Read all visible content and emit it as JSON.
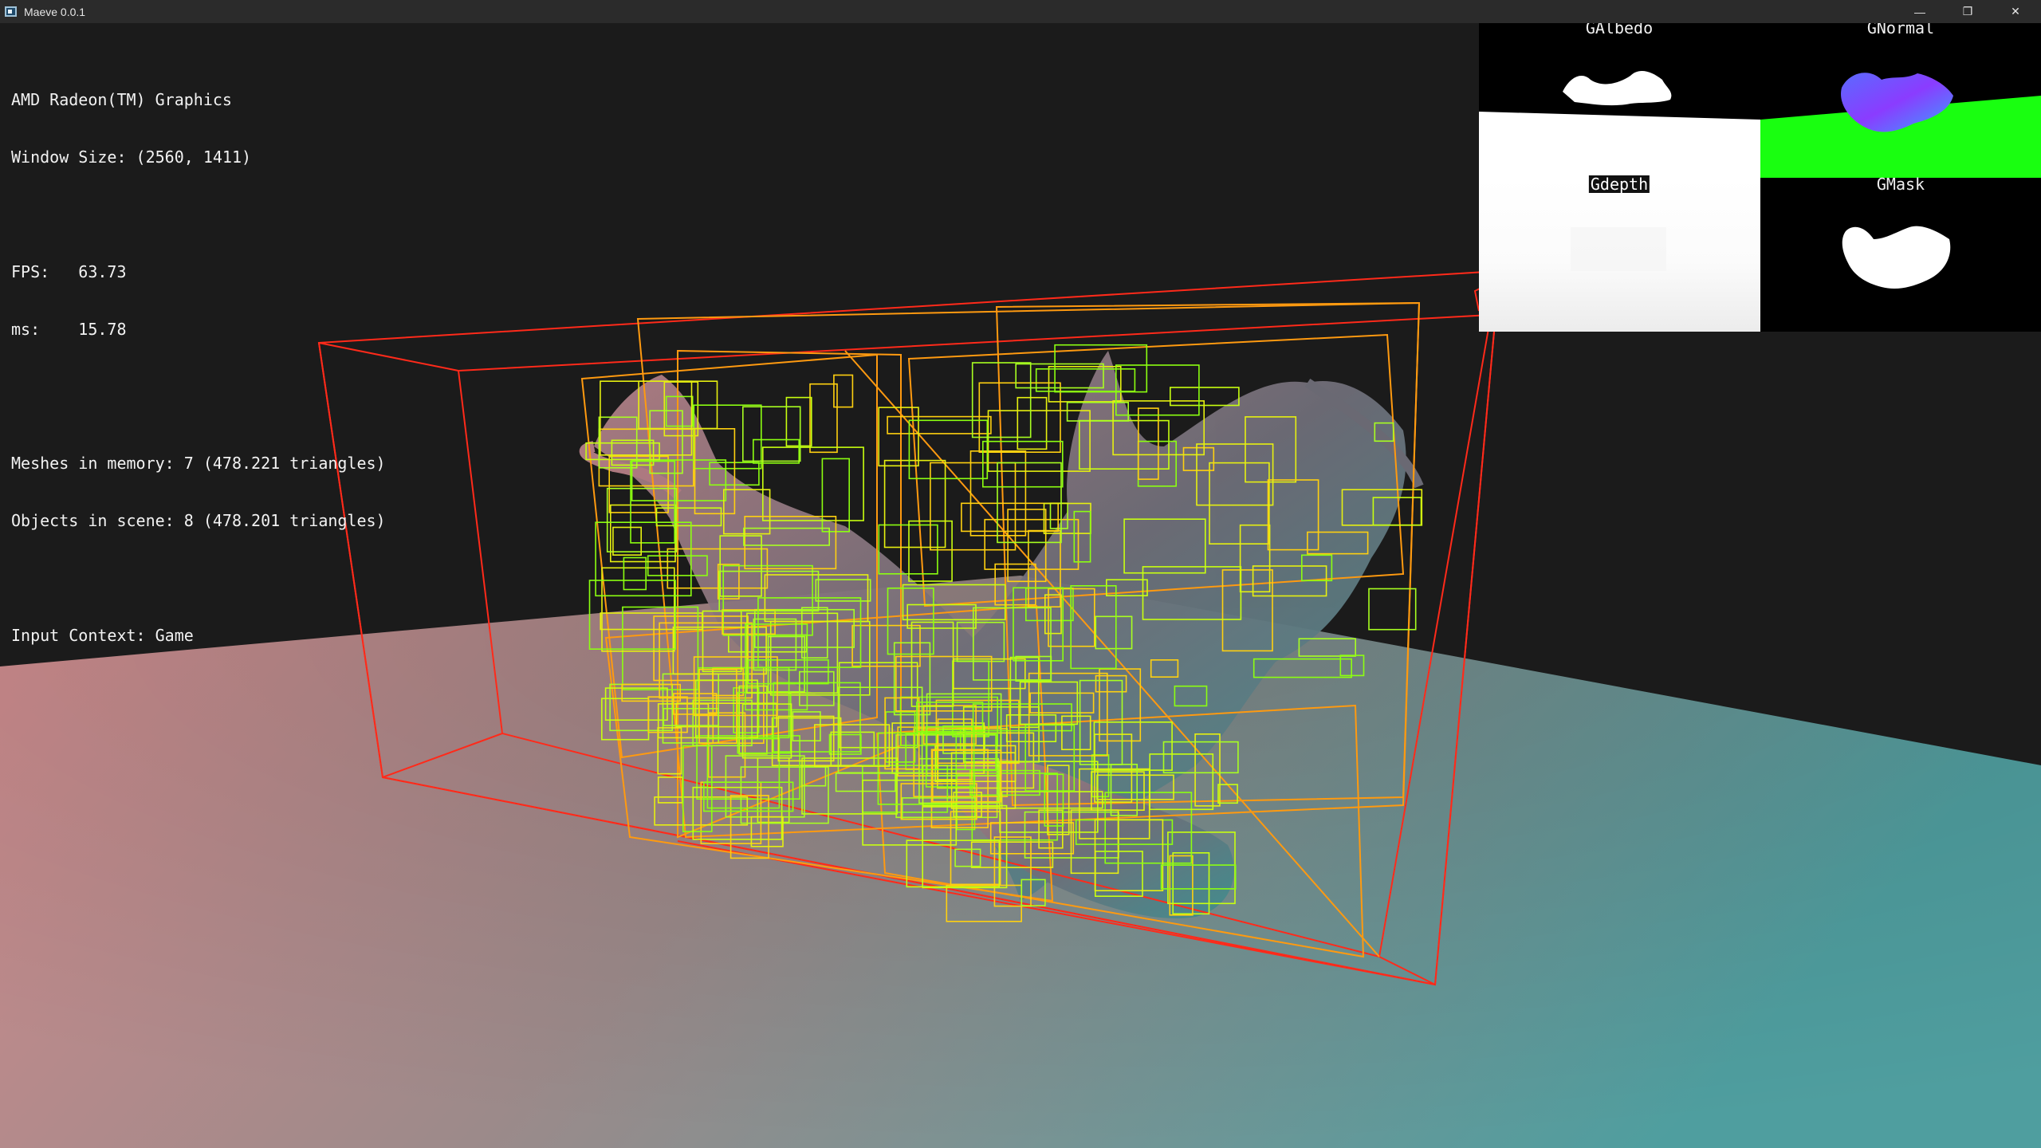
{
  "window": {
    "title": "Maeve 0.0.1",
    "controls": {
      "minimize": "—",
      "maximize": "❐",
      "close": "✕"
    }
  },
  "overlay": {
    "gpu": "AMD Radeon(TM) Graphics",
    "window_size": "Window Size: (2560, 1411)",
    "fps": "FPS:   63.73",
    "ms": "ms:    15.78",
    "meshes": "Meshes in memory: 7 (478.221 triangles)",
    "objects": "Objects in scene: 8 (478.201 triangles)",
    "input_context": "Input Context: Game"
  },
  "gbuffer": {
    "albedo": "GAlbedo",
    "normal": "GNormal",
    "depth": "Gdepth",
    "mask": "GMask"
  },
  "colors": {
    "background": "#1b1b1b",
    "floor_left": "#cf8a8c",
    "floor_right": "#4f9e9f",
    "bvh_root": "#ff2a1a",
    "bvh_mid": "#ff9a10",
    "bvh_leaf": "#8cff10",
    "normal_floor": "#19ff10",
    "normal_model": "#4a55ff"
  },
  "icons": {
    "app": "app-window-icon"
  }
}
